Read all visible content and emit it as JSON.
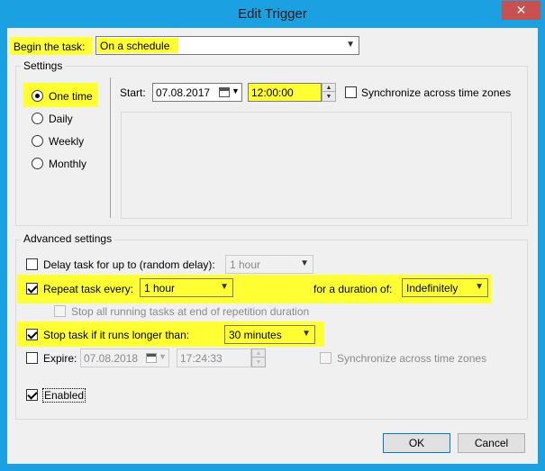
{
  "window": {
    "title": "Edit Trigger",
    "close_glyph": "✕"
  },
  "begin_task": {
    "label": "Begin the task:",
    "value": "On a schedule"
  },
  "settings": {
    "group_label": "Settings",
    "schedule_options": [
      "One time",
      "Daily",
      "Weekly",
      "Monthly"
    ],
    "selected_option": "One time",
    "start_label": "Start:",
    "start_date": "07.08.2017",
    "start_time": "12:00:00",
    "sync_label": "Synchronize across time zones",
    "sync_checked": false
  },
  "advanced": {
    "group_label": "Advanced settings",
    "delay": {
      "label": "Delay task for up to (random delay):",
      "checked": false,
      "value": "1 hour"
    },
    "repeat": {
      "label": "Repeat task every:",
      "checked": true,
      "value": "1 hour",
      "duration_label": "for a duration of:",
      "duration_value": "Indefinitely"
    },
    "stop_all": {
      "label": "Stop all running tasks at end of repetition duration",
      "checked": false
    },
    "stop_longer": {
      "label": "Stop task if it runs longer than:",
      "checked": true,
      "value": "30 minutes"
    },
    "expire": {
      "label": "Expire:",
      "checked": false,
      "date": "07.08.2018",
      "time": "17:24:33",
      "sync_label": "Synchronize across time zones",
      "sync_checked": false
    },
    "enabled": {
      "label": "Enabled",
      "checked": true
    }
  },
  "buttons": {
    "ok": "OK",
    "cancel": "Cancel"
  },
  "colors": {
    "highlight": "#ffff33",
    "titlebar": "#1ba1e2",
    "close": "#c75050"
  }
}
